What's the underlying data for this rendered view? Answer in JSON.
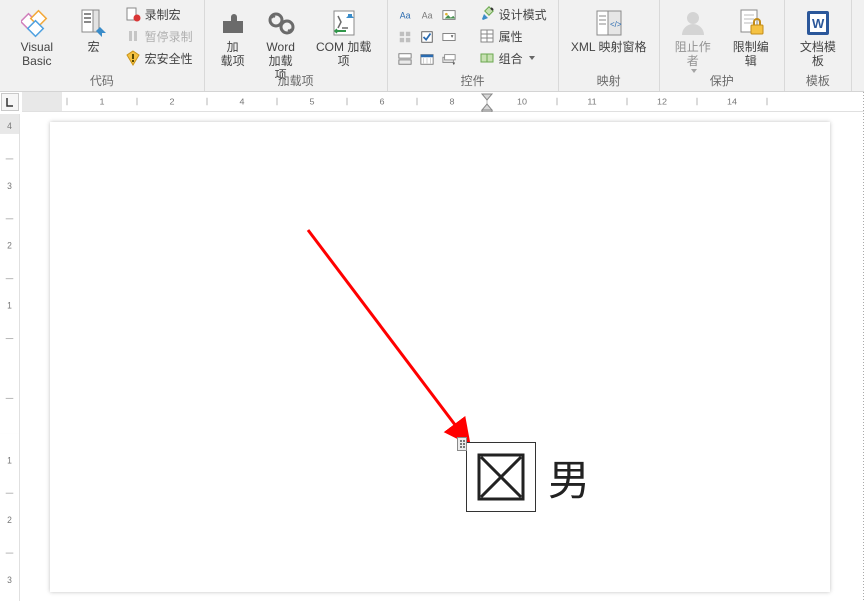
{
  "ribbon": {
    "g_code": {
      "visual_basic": "Visual Basic",
      "macros": "宏",
      "record": "录制宏",
      "pause": "暂停录制",
      "security": "宏安全性",
      "footer": "代码"
    },
    "g_addins": {
      "addins": "加\n载项",
      "word_addins": "Word\n加载项",
      "com_addins": "COM 加载项",
      "footer": "加载项"
    },
    "g_controls": {
      "design": "设计模式",
      "props": "属性",
      "group": "组合",
      "footer": "控件"
    },
    "g_mapping": {
      "xml_pane": "XML 映射窗格",
      "footer": "映射"
    },
    "g_protect": {
      "block_authors": "阻止作者",
      "restrict_edit": "限制编辑",
      "footer": "保护"
    },
    "g_template": {
      "tmpl": "文档模板",
      "footer": "模板"
    }
  },
  "document": {
    "checkbox_checked": true,
    "checkbox_label": "男"
  }
}
